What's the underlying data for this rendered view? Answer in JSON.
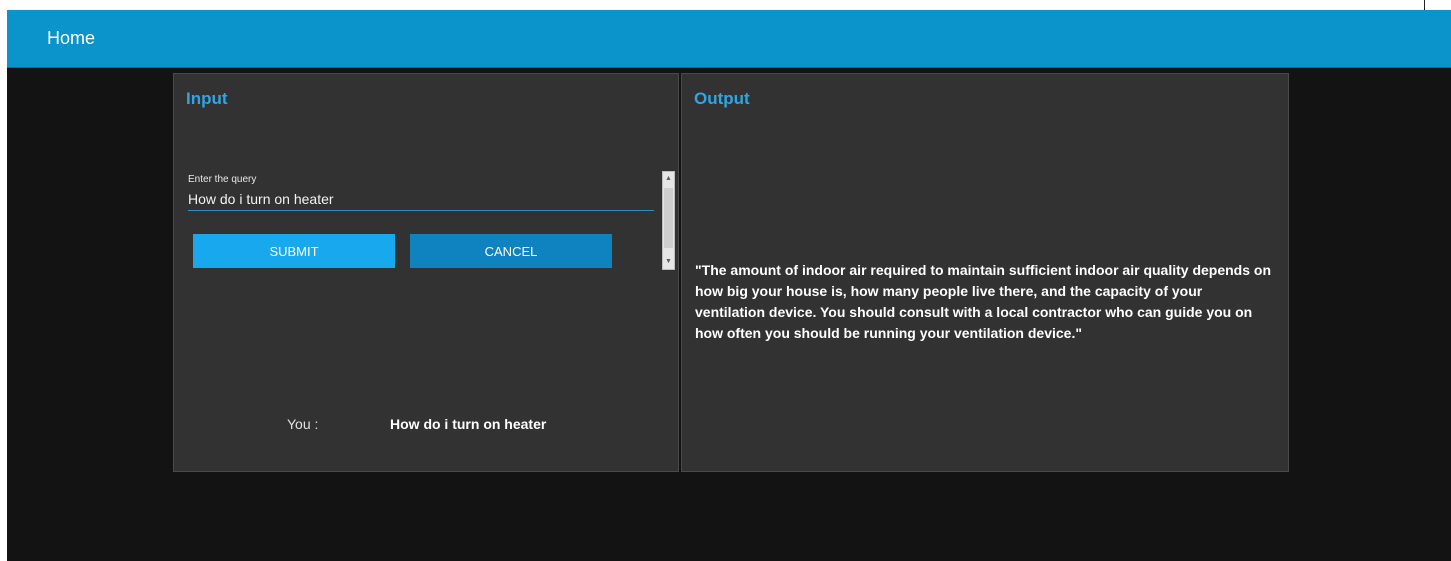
{
  "header": {
    "title": "Home"
  },
  "input_panel": {
    "title": "Input",
    "query_label": "Enter the query",
    "query_value": "How do i turn on heater",
    "submit_label": "SUBMIT",
    "cancel_label": "CANCEL",
    "you_label": "You :",
    "you_value": "How do i turn on heater"
  },
  "output_panel": {
    "title": "Output",
    "response": "\"The amount of indoor air required to maintain sufficient indoor air quality depends on how big your house is, how many people live there, and the capacity of your ventilation device. You should consult with a local contractor who can guide you on how often you should be running your ventilation device.\""
  },
  "colors": {
    "accent": "#0b93cc",
    "submit_button": "#17a8ee",
    "cancel_button": "#0f83c0",
    "panel_title": "#2ea6e5",
    "panel_background": "#323232",
    "app_background": "#131313"
  },
  "icons": {
    "scroll_up": "scroll-up-arrow-icon",
    "scroll_down": "scroll-down-arrow-icon"
  }
}
